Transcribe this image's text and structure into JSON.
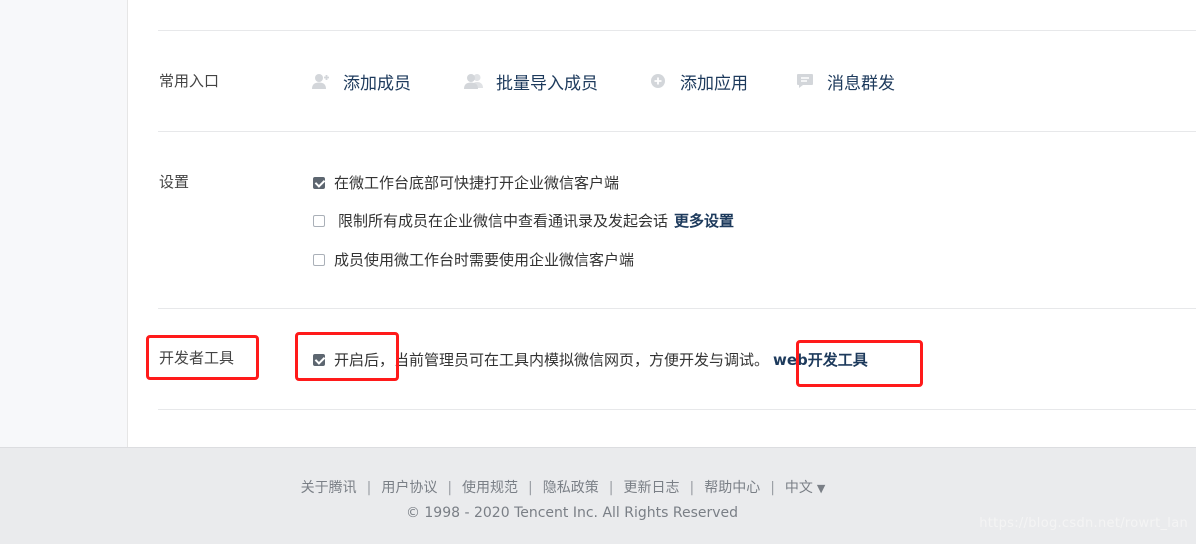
{
  "quick_entry": {
    "label": "常用入口",
    "items": [
      {
        "label": "添加成员",
        "icon": "add-user-icon"
      },
      {
        "label": "批量导入成员",
        "icon": "users-icon"
      },
      {
        "label": "添加应用",
        "icon": "add-app-icon"
      },
      {
        "label": "消息群发",
        "icon": "message-icon"
      }
    ]
  },
  "settings": {
    "label": "设置",
    "options": [
      {
        "text": "在微工作台底部可快捷打开企业微信客户端",
        "checked": true
      },
      {
        "text": "限制所有成员在企业微信中查看通讯录及发起会话",
        "checked": false,
        "link": "更多设置"
      },
      {
        "text": "成员使用微工作台时需要使用企业微信客户端",
        "checked": false
      }
    ]
  },
  "dev_tools": {
    "label": "开发者工具",
    "option_prefix": "开启后，",
    "option_text": "当前管理员可在工具内模拟微信网页，方便开发与调试。",
    "link": "web开发工具",
    "checked": true,
    "highlight_color": "#ff1a1a"
  },
  "footer": {
    "links": [
      "关于腾讯",
      "用户协议",
      "使用规范",
      "隐私政策",
      "更新日志",
      "帮助中心"
    ],
    "language": "中文",
    "copyright": "© 1998 - 2020 Tencent Inc. All Rights Reserved",
    "watermark": "https://blog.csdn.net/rowrt_lan"
  },
  "colors": {
    "link": "#1d3a5c",
    "footer_bg": "#eaebed",
    "highlight": "#ff1a1a"
  }
}
